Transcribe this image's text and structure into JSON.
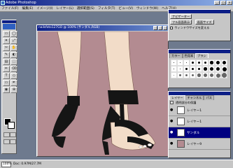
{
  "app": {
    "title": "Adobe Photoshop"
  },
  "menu": [
    "ファイル(F)",
    "編集(E)",
    "イメージ(I)",
    "レイヤー(L)",
    "選択範囲(S)",
    "フィルタ(T)",
    "ビュー(V)",
    "ウィンドウ(W)",
    "ヘルプ(H)"
  ],
  "document": {
    "title": "nailsfoto127GO @ 100% (サンダル,RGB)"
  },
  "navigator_panel": {
    "buttons": [
      "ナビゲーター",
      "フル画面表示",
      "画面サイズ"
    ],
    "checkbox_label": "ウィンドウサイズを変える"
  },
  "brush_panel": {
    "tabs": [
      "カラー",
      "色見本",
      "ブラシ"
    ],
    "brush_sizes": [
      1,
      2,
      3,
      4,
      5,
      6,
      7,
      8,
      9
    ]
  },
  "layers_panel": {
    "tabs": [
      "レイヤー",
      "チャンネル",
      "パス"
    ],
    "option_label": "透明部分の保護",
    "layers": [
      {
        "name": "レイヤー1",
        "selected": false,
        "thumb": "#ffffff"
      },
      {
        "name": "レイヤー1",
        "selected": false,
        "thumb": "#ffffff"
      },
      {
        "name": "サンダル",
        "selected": true,
        "thumb": "#ffffff"
      },
      {
        "name": "レイヤー9",
        "selected": false,
        "thumb": "#b38b91"
      }
    ]
  },
  "status": {
    "zoom": "100%",
    "doc_info": "Doc: 0.97M/27.7M"
  },
  "tools": [
    "▭",
    "◯",
    "✦",
    "⤢",
    "✂",
    "✋",
    "✎",
    "◐",
    "▤",
    "⬚",
    "✏",
    "⌫",
    "T",
    "◇",
    "▭",
    "✒",
    "◉",
    "⊕",
    "⚲",
    "◎"
  ],
  "colors": {
    "canvas": "#b38b91",
    "selection": "#000080",
    "titlebar": "#0c1e86"
  }
}
